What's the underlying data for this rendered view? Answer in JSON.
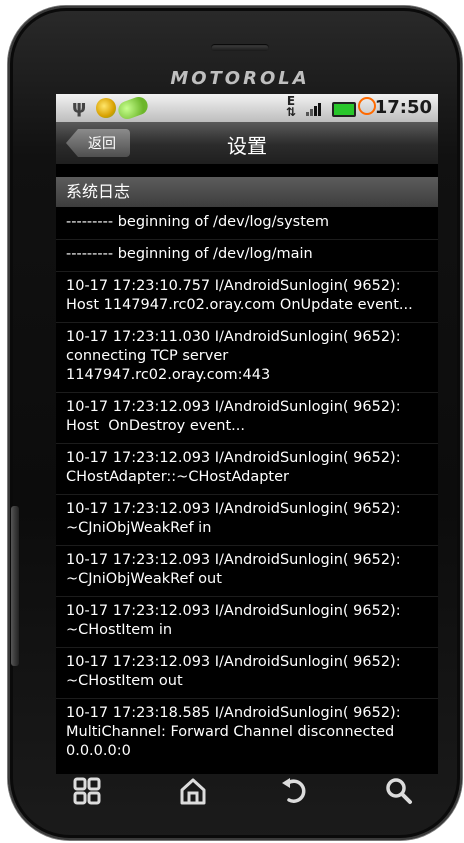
{
  "device": {
    "brand": "MOTOROLA"
  },
  "statusbar": {
    "time": "17:50",
    "data_indicator": "E"
  },
  "titlebar": {
    "back_label": "返回",
    "title": "设置"
  },
  "section": {
    "header": "系统日志"
  },
  "log_entries": [
    "--------- beginning of /dev/log/system",
    "--------- beginning of /dev/log/main",
    "10-17 17:23:10.757 I/AndroidSunlogin( 9652): Host 1147947.rc02.oray.com OnUpdate event...",
    "10-17 17:23:11.030 I/AndroidSunlogin( 9652): connecting TCP server 1147947.rc02.oray.com:443",
    "10-17 17:23:12.093 I/AndroidSunlogin( 9652): Host  OnDestroy event...",
    "10-17 17:23:12.093 I/AndroidSunlogin( 9652): CHostAdapter::~CHostAdapter",
    "10-17 17:23:12.093 I/AndroidSunlogin( 9652): ~CJniObjWeakRef in",
    "10-17 17:23:12.093 I/AndroidSunlogin( 9652): ~CJniObjWeakRef out",
    "10-17 17:23:12.093 I/AndroidSunlogin( 9652): ~CHostItem in",
    "10-17 17:23:12.093 I/AndroidSunlogin( 9652): ~CHostItem out",
    "10-17 17:23:18.585 I/AndroidSunlogin( 9652): MultiChannel: Forward Channel disconnected 0.0.0.0:0"
  ],
  "nav": {
    "icons": [
      "grid-menu-icon",
      "home-icon",
      "back-arrow-icon",
      "search-icon"
    ]
  },
  "colors": {
    "screen_bg": "#000000",
    "battery": "#29c62b",
    "alarm": "#ff6a00"
  }
}
